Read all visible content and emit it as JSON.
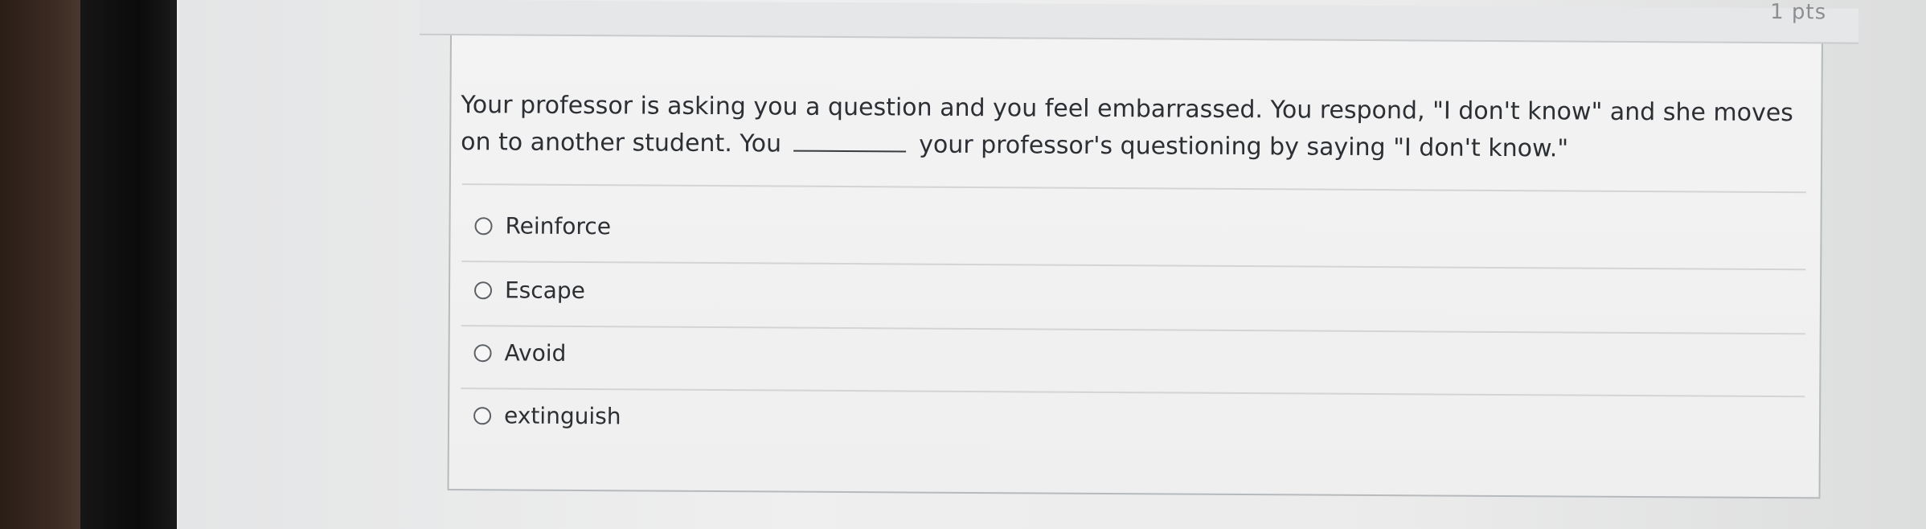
{
  "quiz": {
    "points_label": "1 pts",
    "question": {
      "part1": "Your professor is asking you a question and you feel embarrassed. You respond, \"I don't know\" and she moves on to another student. You",
      "part2": "your professor's questioning by saying \"I don't know.\""
    },
    "answers": [
      {
        "label": "Reinforce"
      },
      {
        "label": "Escape"
      },
      {
        "label": "Avoid"
      },
      {
        "label": "extinguish"
      }
    ]
  }
}
